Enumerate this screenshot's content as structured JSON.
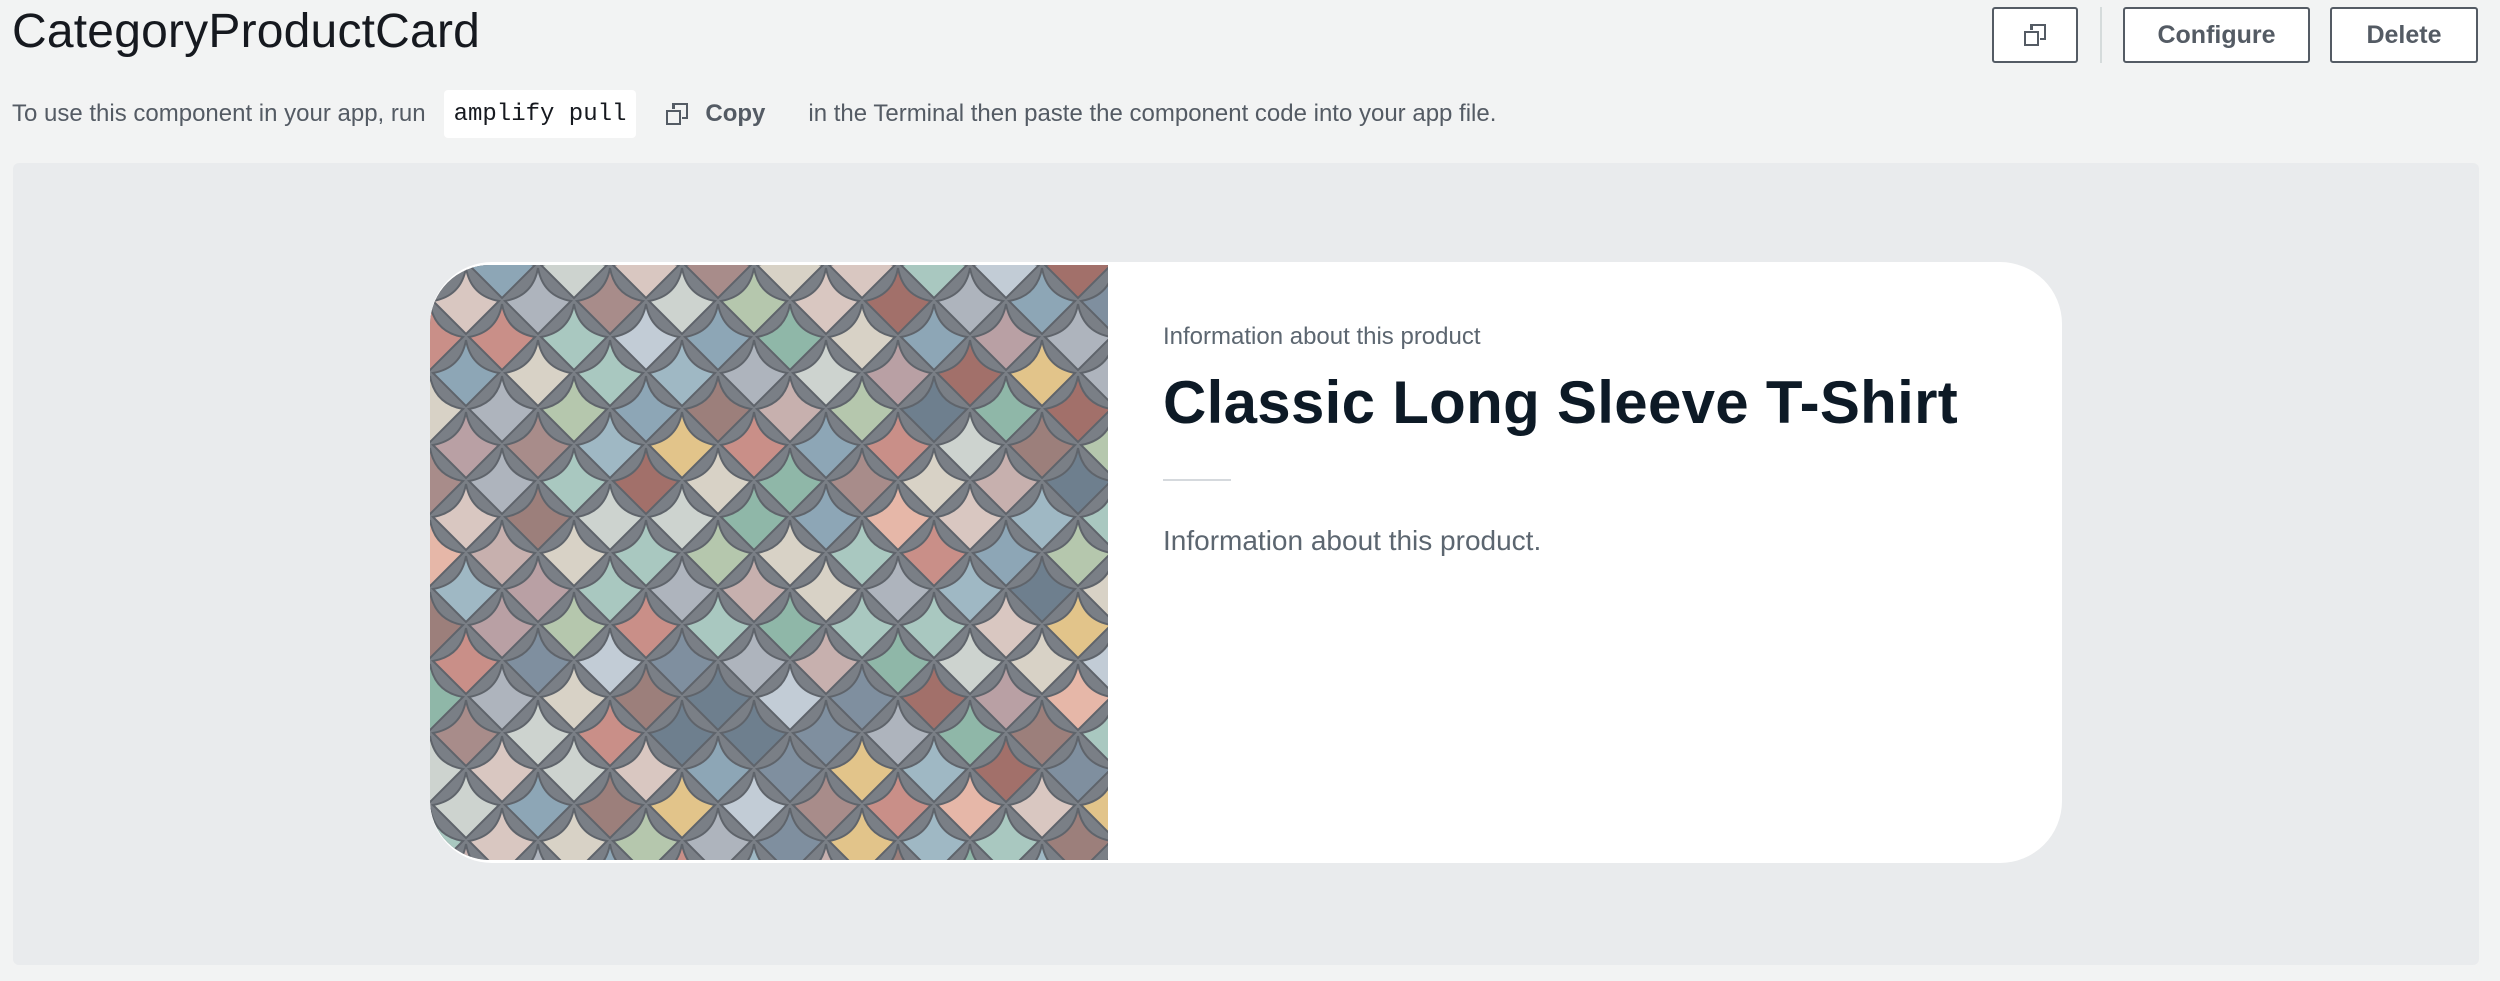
{
  "header": {
    "title": "CategoryProductCard",
    "actions": {
      "duplicate_icon": "copy-icon",
      "configure_label": "Configure",
      "delete_label": "Delete"
    }
  },
  "instructions": {
    "prefix": "To use this component in your app, run",
    "command": "amplify pull",
    "copy_icon": "copy-icon",
    "copy_label": "Copy",
    "suffix": "in the Terminal then paste the component code into your app file."
  },
  "preview": {
    "card": {
      "image_description_icon": "mosaic-tile-image",
      "eyebrow": "Information about this product",
      "title": "Classic Long Sleeve T-Shirt",
      "description": "Information about this product."
    }
  },
  "colors": {
    "page_bg": "#f2f3f3",
    "preview_bg": "#e9ebed",
    "card_bg": "#ffffff",
    "title_text": "#0d1a26",
    "muted_text": "#5c6670",
    "button_border": "#545b64"
  }
}
